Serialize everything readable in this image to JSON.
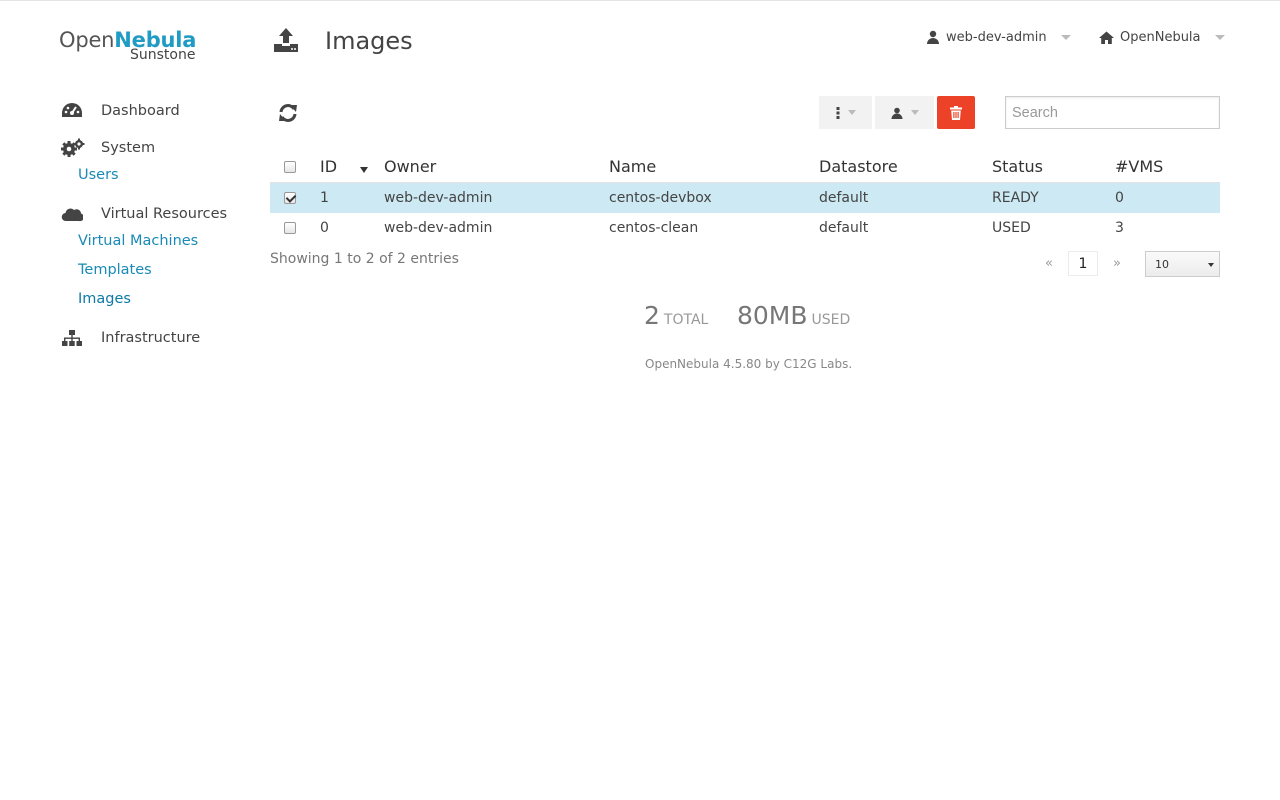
{
  "app": {
    "logo_part1": "Open",
    "logo_part2": "Nebula",
    "logo_sub": "Sunstone"
  },
  "sidebar": {
    "dashboard": "Dashboard",
    "system": "System",
    "users": "Users",
    "virtual_resources": "Virtual Resources",
    "virtual_machines": "Virtual Machines",
    "templates": "Templates",
    "images": "Images",
    "infrastructure": "Infrastructure"
  },
  "header": {
    "title": "Images",
    "user": "web-dev-admin",
    "zone": "OpenNebula"
  },
  "search": {
    "placeholder": "Search"
  },
  "table": {
    "columns": [
      "ID",
      "Owner",
      "Name",
      "Datastore",
      "Status",
      "#VMS"
    ],
    "rows": [
      {
        "id": "1",
        "owner": "web-dev-admin",
        "name": "centos-devbox",
        "datastore": "default",
        "status": "READY",
        "vms": "0",
        "selected": true
      },
      {
        "id": "0",
        "owner": "web-dev-admin",
        "name": "centos-clean",
        "datastore": "default",
        "status": "USED",
        "vms": "3",
        "selected": false
      }
    ],
    "info": "Showing 1 to 2 of 2 entries"
  },
  "pager": {
    "prev": "«",
    "page": "1",
    "next": "»",
    "page_size": "10"
  },
  "stats": {
    "total_num": "2",
    "total_label": "TOTAL",
    "used_num": "80MB",
    "used_label": "USED"
  },
  "footer": {
    "text": "OpenNebula 4.5.80 by C12G Labs."
  },
  "colors": {
    "accent": "#1a8ab6",
    "danger": "#ec4227",
    "selected_row": "#cce9f4"
  }
}
